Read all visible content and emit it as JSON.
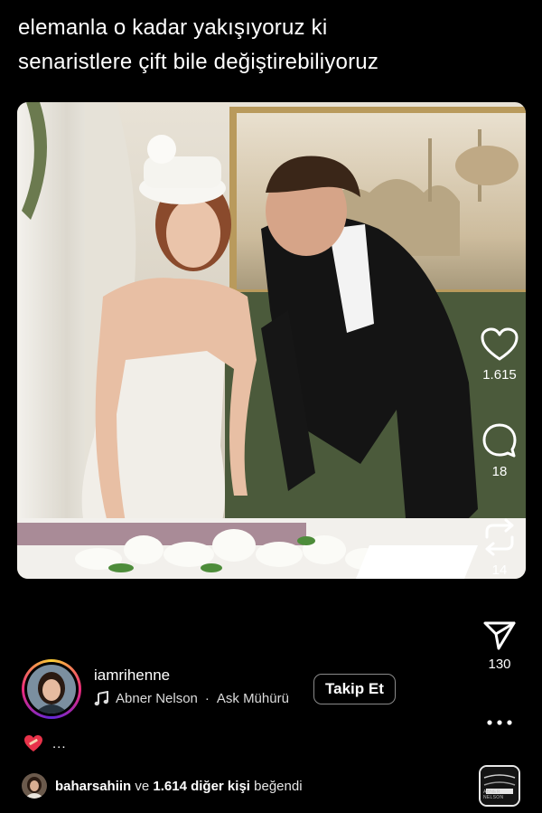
{
  "post": {
    "caption_line1": "elemanla o kadar yakışıyoruz ki",
    "caption_line2": "senaristlere çift bile değiştirebiliyoruz"
  },
  "actions": {
    "like_count": "1.615",
    "comment_count": "18",
    "repost_count": "14",
    "share_count": "130",
    "like_icon": "heart-icon",
    "comment_icon": "comment-bubble-icon",
    "repost_icon": "repost-icon",
    "share_icon": "paper-plane-icon",
    "more_icon": "more-dots-icon"
  },
  "author": {
    "username": "iamrihenne",
    "music_artist": "Abner Nelson",
    "separator": "·",
    "music_title": "Ask Mühürü",
    "follow_label": "Takip Et"
  },
  "reaction": {
    "emoji": "❤️‍🩹",
    "dots": "..."
  },
  "likes": {
    "user": "baharsahiin",
    "connector": "ve",
    "others": "1.614 diğer kişi",
    "suffix": "beğendi"
  },
  "audio": {
    "thumb_label": "ABNER NELSON"
  },
  "colors": {
    "background": "#000000",
    "text": "#ffffff",
    "story_ring": [
      "#f9ce34",
      "#ee2a7b",
      "#6228d7"
    ]
  }
}
